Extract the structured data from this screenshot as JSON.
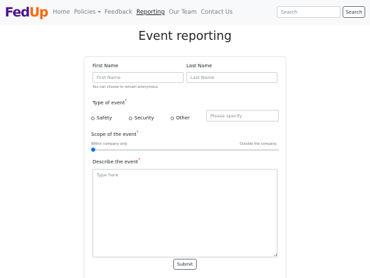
{
  "brand": {
    "part1": "Fed",
    "part2": "Up",
    "color1": "#4d148c",
    "color2": "#ff6600"
  },
  "nav": {
    "home": "Home",
    "policies": "Policies",
    "feedback": "Feedback",
    "reporting": "Reporting",
    "our_team": "Our Team",
    "contact_us": "Contact Us"
  },
  "search": {
    "placeholder": "Search",
    "button": "Search"
  },
  "page_title": "Event reporting",
  "form": {
    "first_name": {
      "label": "First Name",
      "placeholder": "First Name"
    },
    "last_name": {
      "label": "Last Name",
      "placeholder": "Last Name"
    },
    "anonymous_hint": "You can choose to remain anonymous.",
    "event_type": {
      "label": "Type of event",
      "required_mark": "*",
      "options": [
        "Safety",
        "Security",
        "Other"
      ],
      "other_placeholder": "Please specify"
    },
    "scope": {
      "label": "Scope of the event",
      "required_mark": "*",
      "min_label": "Within company only",
      "max_label": "Outside the company",
      "value": 0
    },
    "description": {
      "label": "Describe the event",
      "required_mark": "*",
      "placeholder": "Type here"
    },
    "submit": "Submit"
  },
  "colors": {
    "accent": "#0d6efd",
    "required": "#dc3545"
  }
}
